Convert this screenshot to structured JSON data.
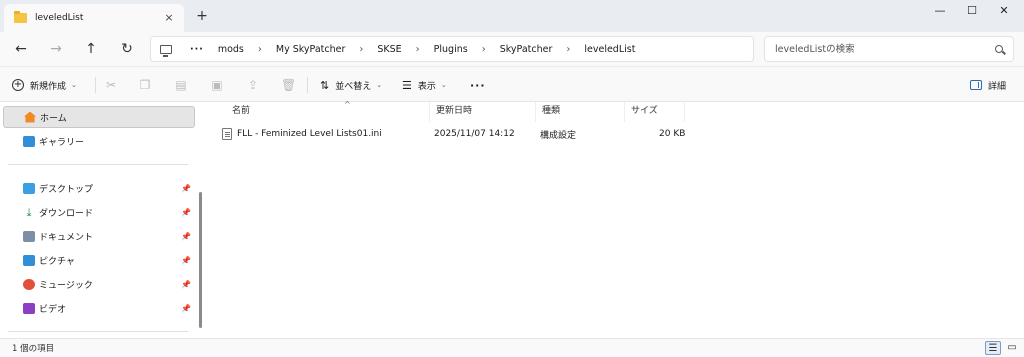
{
  "tab": {
    "title": "leveledList",
    "close": "×",
    "add": "+"
  },
  "window": {
    "minimize": "—",
    "maximize": "☐",
    "close": "✕"
  },
  "nav": {
    "back": "←",
    "forward": "→",
    "up": "↑",
    "refresh": "↻"
  },
  "breadcrumb": {
    "more": "···",
    "items": [
      "mods",
      "My SkyPatcher",
      "SKSE",
      "Plugins",
      "SkyPatcher",
      "leveledList"
    ],
    "separator": "›"
  },
  "search": {
    "placeholder": "leveledListの検索"
  },
  "commands": {
    "new_label": "新規作成",
    "sort_label": "並べ替え",
    "view_label": "表示",
    "more_label": "···",
    "details_label": "詳細"
  },
  "sidebar": {
    "items": [
      {
        "label": "ホーム",
        "icon": "home-icon"
      },
      {
        "label": "ギャラリー",
        "icon": "gallery-icon"
      },
      {
        "label": "デスクトップ",
        "icon": "desktop-icon"
      },
      {
        "label": "ダウンロード",
        "icon": "download-icon"
      },
      {
        "label": "ドキュメント",
        "icon": "documents-icon"
      },
      {
        "label": "ピクチャ",
        "icon": "pictures-icon"
      },
      {
        "label": "ミュージック",
        "icon": "music-icon"
      },
      {
        "label": "ビデオ",
        "icon": "videos-icon"
      }
    ]
  },
  "table": {
    "columns": [
      "名前",
      "更新日時",
      "種類",
      "サイズ"
    ],
    "rows": [
      {
        "name": "FLL - Feminized Level Lists01.ini",
        "modified": "2025/11/07 14:12",
        "type": "構成設定",
        "size": "20 KB"
      }
    ]
  },
  "status": {
    "text": "1 個の項目"
  },
  "colors": {
    "accent": "#2b6cb0",
    "selected": "#e5e5e5",
    "folder": "#f4c542"
  }
}
